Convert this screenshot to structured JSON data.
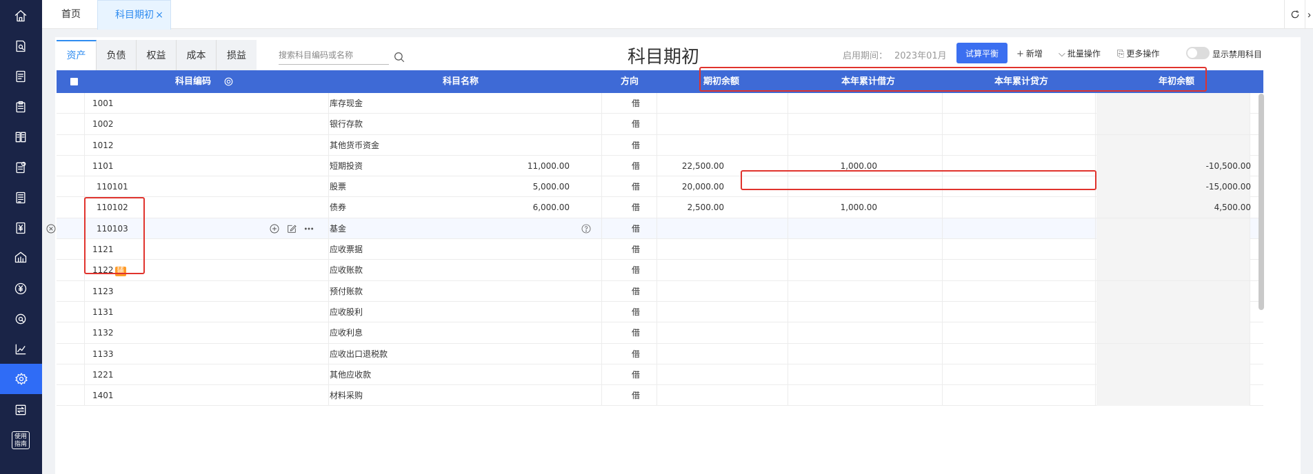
{
  "sidebar": {
    "icons": [
      "home-icon",
      "voucher-search-icon",
      "document-list-icon",
      "clipboard-icon",
      "ledger-icon",
      "report-icon",
      "notes-icon",
      "yuan-doc-icon",
      "building-icon",
      "yuan-circle-icon",
      "search-circle-icon",
      "trend-chart-icon",
      "settings-icon",
      "transfer-icon"
    ],
    "guide_label": "使用指南"
  },
  "top_tabs": {
    "home": "首页",
    "active": "科目期初",
    "close": "×"
  },
  "category_tabs": [
    "资产",
    "负债",
    "权益",
    "成本",
    "损益"
  ],
  "search": {
    "placeholder": "搜索科目编码或名称"
  },
  "page_title": "科目期初",
  "period": {
    "label": "启用期间：",
    "value": "2023年01月"
  },
  "toolbar": {
    "balance_btn": "试算平衡",
    "add": "新增",
    "batch": "批量操作",
    "more": "更多操作",
    "show_disabled": "显示禁用科目"
  },
  "table": {
    "headers": {
      "code": "科目编码",
      "name": "科目名称",
      "direction": "方向",
      "opening": "期初余额",
      "debit": "本年累计借方",
      "credit": "本年累计贷方",
      "year_start": "年初余额"
    },
    "rows": [
      {
        "code": "1001",
        "name": "库存现金",
        "dir": "借",
        "opening": "",
        "debit": "",
        "credit": "",
        "year": ""
      },
      {
        "code": "1002",
        "name": "银行存款",
        "dir": "借",
        "opening": "",
        "debit": "",
        "credit": "",
        "year": ""
      },
      {
        "code": "1012",
        "name": "其他货币资金",
        "dir": "借",
        "opening": "",
        "debit": "",
        "credit": "",
        "year": ""
      },
      {
        "code": "1101",
        "name": "短期投资",
        "dir": "借",
        "opening": "11,000.00",
        "debit": "22,500.00",
        "credit": "1,000.00",
        "year": "-10,500.00"
      },
      {
        "code": "110101",
        "name": "股票",
        "dir": "借",
        "opening": "5,000.00",
        "debit": "20,000.00",
        "credit": "",
        "year": "-15,000.00"
      },
      {
        "code": "110102",
        "name": "债券",
        "dir": "借",
        "opening": "6,000.00",
        "debit": "2,500.00",
        "credit": "1,000.00",
        "year": "4,500.00"
      },
      {
        "code": "110103",
        "name": "基金",
        "dir": "借",
        "opening": "",
        "debit": "",
        "credit": "",
        "year": ""
      },
      {
        "code": "1121",
        "name": "应收票据",
        "dir": "借",
        "opening": "",
        "debit": "",
        "credit": "",
        "year": ""
      },
      {
        "code": "1122",
        "name": "应收账款",
        "dir": "借",
        "opening": "",
        "debit": "",
        "credit": "",
        "year": "",
        "badge": "辅"
      },
      {
        "code": "1123",
        "name": "预付账款",
        "dir": "借",
        "opening": "",
        "debit": "",
        "credit": "",
        "year": ""
      },
      {
        "code": "1131",
        "name": "应收股利",
        "dir": "借",
        "opening": "",
        "debit": "",
        "credit": "",
        "year": ""
      },
      {
        "code": "1132",
        "name": "应收利息",
        "dir": "借",
        "opening": "",
        "debit": "",
        "credit": "",
        "year": ""
      },
      {
        "code": "1133",
        "name": "应收出口退税款",
        "dir": "借",
        "opening": "",
        "debit": "",
        "credit": "",
        "year": ""
      },
      {
        "code": "1221",
        "name": "其他应收款",
        "dir": "借",
        "opening": "",
        "debit": "",
        "credit": "",
        "year": ""
      },
      {
        "code": "1401",
        "name": "材料采购",
        "dir": "借",
        "opening": "",
        "debit": "",
        "credit": "",
        "year": ""
      }
    ]
  },
  "colors": {
    "sidebar": "#1a2447",
    "accent": "#2f8cf0",
    "header": "#3e6ad6",
    "button": "#3b6ff0",
    "highlight": "#e0322c",
    "badge": "#ff9c2a"
  }
}
